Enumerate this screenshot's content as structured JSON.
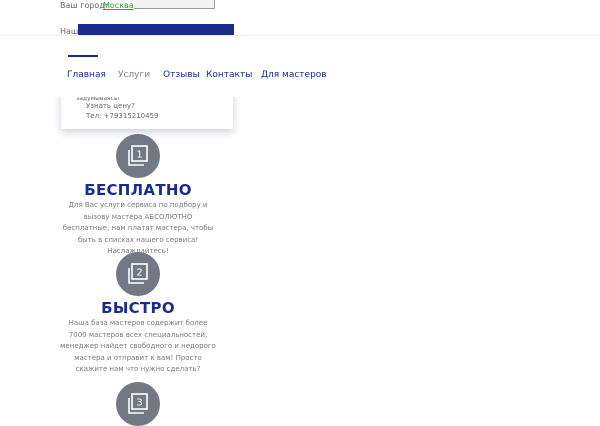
{
  "top_card": {
    "city_label": "Ваш город:",
    "city_value": "Москва",
    "address_label": "Наш адрес:"
  },
  "nav": {
    "items": [
      {
        "label": "Главная"
      },
      {
        "label": "Услуги"
      },
      {
        "label": "Отзывы"
      },
      {
        "label": "Контакты"
      },
      {
        "label": "Для мастеров"
      }
    ]
  },
  "info_card": {
    "small_text": "задумываясь!",
    "price_link": "Узнать цену?",
    "phone": "Тел: +79315210459"
  },
  "features": [
    {
      "number": "1",
      "title": "БЕСПЛАТНО",
      "description": "Для Вас услуги сервиса по подбору и вызову мастера АБСОЛЮТНО бесплатные, нам платят мастера, чтобы быть в списках нашего сервиса! Наслаждайтесь!"
    },
    {
      "number": "2",
      "title": "БЫСТРО",
      "description": "Наша база мастеров содержит более 7000 мастеров всех специальностей, менеджер найдет свободного и недорого мастера и отправит к вам! Просто скажите нам что нужно сделать?"
    },
    {
      "number": "3",
      "title": "",
      "description": ""
    }
  ],
  "colors": {
    "brand": "#1a2c8c",
    "icon_circle": "#737984",
    "city_link": "#2e9a3a"
  }
}
